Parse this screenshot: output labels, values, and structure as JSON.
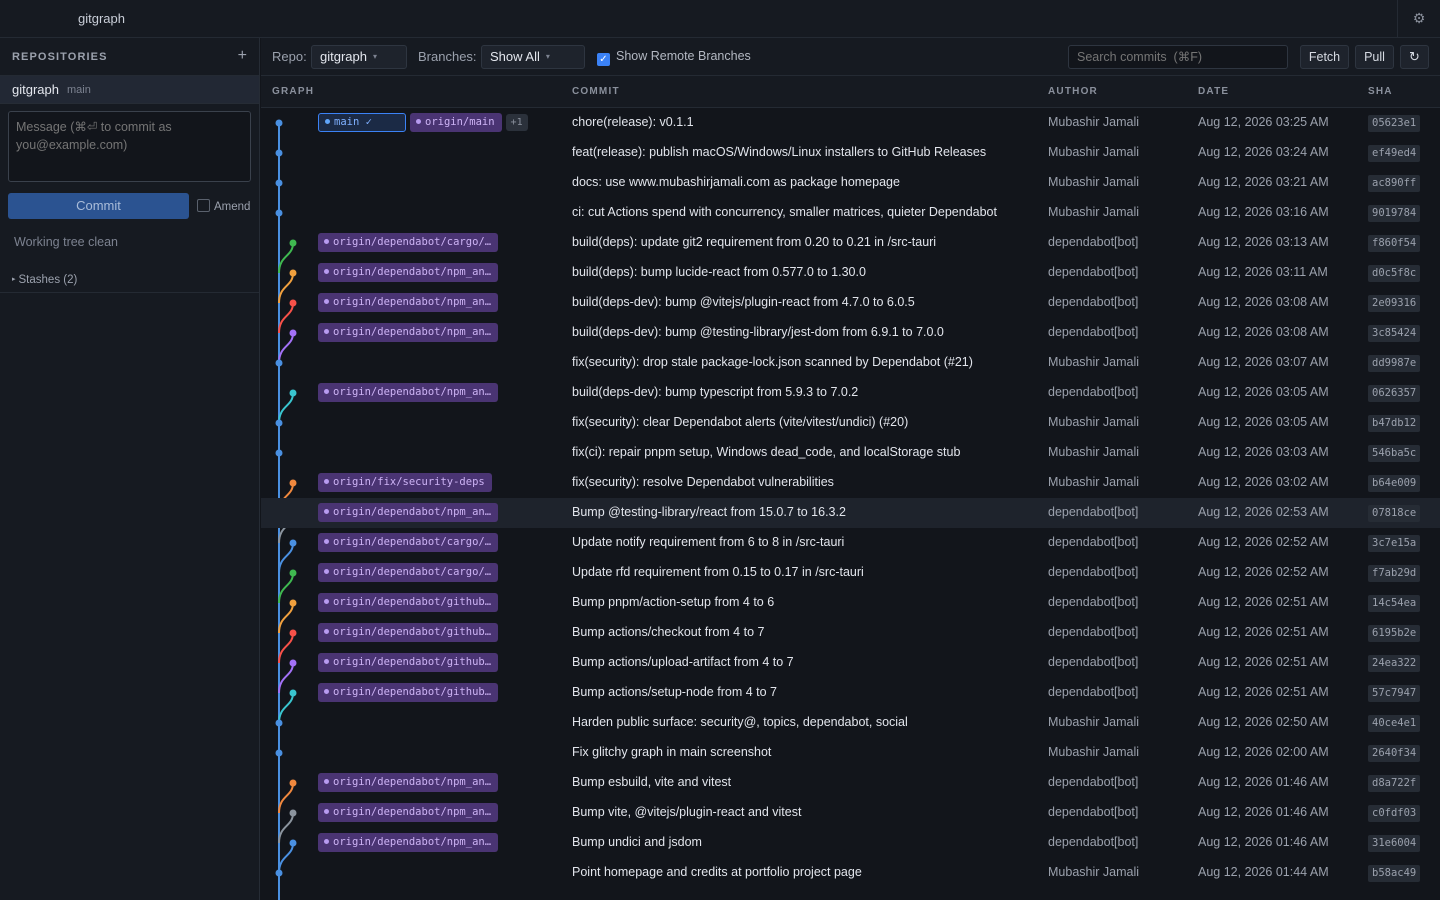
{
  "app": {
    "title": "gitgraph"
  },
  "sidebar": {
    "title": "REPOSITORIES",
    "repo": {
      "name": "gitgraph",
      "branch": "main"
    },
    "message_placeholder": "Message (⌘⏎ to commit as you@example.com)",
    "commit_label": "Commit",
    "amend_label": "Amend",
    "status": "Working tree clean",
    "stashes_label": "Stashes (2)"
  },
  "toolbar": {
    "repo_label": "Repo:",
    "repo_value": "gitgraph",
    "branches_label": "Branches:",
    "branches_value": "Show All",
    "remote_label": "Show Remote Branches",
    "search_placeholder": "Search commits  (⌘F)",
    "fetch_label": "Fetch",
    "pull_label": "Pull"
  },
  "columns": {
    "graph": "GRAPH",
    "commit": "COMMIT",
    "author": "AUTHOR",
    "date": "DATE",
    "sha": "SHA"
  },
  "colors": {
    "main_lane": "#4a90e2",
    "branch_colors": [
      "#3fb950",
      "#f0883e",
      "#f85149",
      "#a371f7",
      "#39c5cf",
      "#8b949e",
      "#4a90e2"
    ],
    "ref_bg": "#4a3473",
    "selected_row": "#1e232c"
  },
  "commits": [
    {
      "message": "chore(release): v0.1.1",
      "author": "Mubashir Jamali",
      "date": "Aug 12, 2026 03:25 AM",
      "sha": "05623e1",
      "refs": [
        "main ✓",
        "origin/main",
        "+1"
      ],
      "lane_color": ""
    },
    {
      "message": "feat(release): publish macOS/Windows/Linux installers to GitHub Releases",
      "author": "Mubashir Jamali",
      "date": "Aug 12, 2026 03:24 AM",
      "sha": "ef49ed4",
      "refs": [],
      "lane_color": ""
    },
    {
      "message": "docs: use www.mubashirjamali.com as package homepage",
      "author": "Mubashir Jamali",
      "date": "Aug 12, 2026 03:21 AM",
      "sha": "ac890ff",
      "refs": [],
      "lane_color": ""
    },
    {
      "message": "ci: cut Actions spend with concurrency, smaller matrices, quieter Dependabot",
      "author": "Mubashir Jamali",
      "date": "Aug 12, 2026 03:16 AM",
      "sha": "9019784",
      "refs": [],
      "lane_color": ""
    },
    {
      "message": "build(deps): update git2 requirement from 0.20 to 0.21 in /src-tauri",
      "author": "dependabot[bot]",
      "date": "Aug 12, 2026 03:13 AM",
      "sha": "f860f54",
      "refs": [
        "origin/dependabot/cargo/…"
      ],
      "lane_color": "#3fb950"
    },
    {
      "message": "build(deps): bump lucide-react from 0.577.0 to 1.30.0",
      "author": "dependabot[bot]",
      "date": "Aug 12, 2026 03:11 AM",
      "sha": "d0c5f8c",
      "refs": [
        "origin/dependabot/npm_an…"
      ],
      "lane_color": "#f0a03e"
    },
    {
      "message": "build(deps-dev): bump @vitejs/plugin-react from 4.7.0 to 6.0.5",
      "author": "dependabot[bot]",
      "date": "Aug 12, 2026 03:08 AM",
      "sha": "2e09316",
      "refs": [
        "origin/dependabot/npm_an…"
      ],
      "lane_color": "#f85149"
    },
    {
      "message": "build(deps-dev): bump @testing-library/jest-dom from 6.9.1 to 7.0.0",
      "author": "dependabot[bot]",
      "date": "Aug 12, 2026 03:08 AM",
      "sha": "3c85424",
      "refs": [
        "origin/dependabot/npm_an…"
      ],
      "lane_color": "#a371f7"
    },
    {
      "message": "fix(security): drop stale package-lock.json scanned by Dependabot (#21)",
      "author": "Mubashir Jamali",
      "date": "Aug 12, 2026 03:07 AM",
      "sha": "dd9987e",
      "refs": [],
      "lane_color": ""
    },
    {
      "message": "build(deps-dev): bump typescript from 5.9.3 to 7.0.2",
      "author": "dependabot[bot]",
      "date": "Aug 12, 2026 03:05 AM",
      "sha": "0626357",
      "refs": [
        "origin/dependabot/npm_an…"
      ],
      "lane_color": "#39c5cf"
    },
    {
      "message": "fix(security): clear Dependabot alerts (vite/vitest/undici) (#20)",
      "author": "Mubashir Jamali",
      "date": "Aug 12, 2026 03:05 AM",
      "sha": "b47db12",
      "refs": [],
      "lane_color": ""
    },
    {
      "message": "fix(ci): repair pnpm setup, Windows dead_code, and localStorage stub",
      "author": "Mubashir Jamali",
      "date": "Aug 12, 2026 03:03 AM",
      "sha": "546ba5c",
      "refs": [],
      "lane_color": ""
    },
    {
      "message": "fix(security): resolve Dependabot vulnerabilities",
      "author": "Mubashir Jamali",
      "date": "Aug 12, 2026 03:02 AM",
      "sha": "b64e009",
      "refs": [
        "origin/fix/security-deps"
      ],
      "lane_color": "#f0883e"
    },
    {
      "message": "Bump @testing-library/react from 15.0.7 to 16.3.2",
      "author": "dependabot[bot]",
      "date": "Aug 12, 2026 02:53 AM",
      "sha": "07818ce",
      "refs": [
        "origin/dependabot/npm_an…"
      ],
      "lane_color": "#8b949e",
      "selected": true
    },
    {
      "message": "Update notify requirement from 6 to 8 in /src-tauri",
      "author": "dependabot[bot]",
      "date": "Aug 12, 2026 02:52 AM",
      "sha": "3c7e15a",
      "refs": [
        "origin/dependabot/cargo/…"
      ],
      "lane_color": "#4a90e2"
    },
    {
      "message": "Update rfd requirement from 0.15 to 0.17 in /src-tauri",
      "author": "dependabot[bot]",
      "date": "Aug 12, 2026 02:52 AM",
      "sha": "f7ab29d",
      "refs": [
        "origin/dependabot/cargo/…"
      ],
      "lane_color": "#3fb950"
    },
    {
      "message": "Bump pnpm/action-setup from 4 to 6",
      "author": "dependabot[bot]",
      "date": "Aug 12, 2026 02:51 AM",
      "sha": "14c54ea",
      "refs": [
        "origin/dependabot/github…"
      ],
      "lane_color": "#f0a03e"
    },
    {
      "message": "Bump actions/checkout from 4 to 7",
      "author": "dependabot[bot]",
      "date": "Aug 12, 2026 02:51 AM",
      "sha": "6195b2e",
      "refs": [
        "origin/dependabot/github…"
      ],
      "lane_color": "#f85149"
    },
    {
      "message": "Bump actions/upload-artifact from 4 to 7",
      "author": "dependabot[bot]",
      "date": "Aug 12, 2026 02:51 AM",
      "sha": "24ea322",
      "refs": [
        "origin/dependabot/github…"
      ],
      "lane_color": "#a371f7"
    },
    {
      "message": "Bump actions/setup-node from 4 to 7",
      "author": "dependabot[bot]",
      "date": "Aug 12, 2026 02:51 AM",
      "sha": "57c7947",
      "refs": [
        "origin/dependabot/github…"
      ],
      "lane_color": "#39c5cf"
    },
    {
      "message": "Harden public surface: security@, topics, dependabot, social",
      "author": "Mubashir Jamali",
      "date": "Aug 12, 2026 02:50 AM",
      "sha": "40ce4e1",
      "refs": [],
      "lane_color": ""
    },
    {
      "message": "Fix glitchy graph in main screenshot",
      "author": "Mubashir Jamali",
      "date": "Aug 12, 2026 02:00 AM",
      "sha": "2640f34",
      "refs": [],
      "lane_color": ""
    },
    {
      "message": "Bump esbuild, vite and vitest",
      "author": "dependabot[bot]",
      "date": "Aug 12, 2026 01:46 AM",
      "sha": "d8a722f",
      "refs": [
        "origin/dependabot/npm_an…"
      ],
      "lane_color": "#f0883e"
    },
    {
      "message": "Bump vite, @vitejs/plugin-react and vitest",
      "author": "dependabot[bot]",
      "date": "Aug 12, 2026 01:46 AM",
      "sha": "c0fdf03",
      "refs": [
        "origin/dependabot/npm_an…"
      ],
      "lane_color": "#8b949e"
    },
    {
      "message": "Bump undici and jsdom",
      "author": "dependabot[bot]",
      "date": "Aug 12, 2026 01:46 AM",
      "sha": "31e6004",
      "refs": [
        "origin/dependabot/npm_an…"
      ],
      "lane_color": "#4a90e2"
    },
    {
      "message": "Point homepage and credits at portfolio project page",
      "author": "Mubashir Jamali",
      "date": "Aug 12, 2026 01:44 AM",
      "sha": "b58ac49",
      "refs": [],
      "lane_color": ""
    }
  ]
}
